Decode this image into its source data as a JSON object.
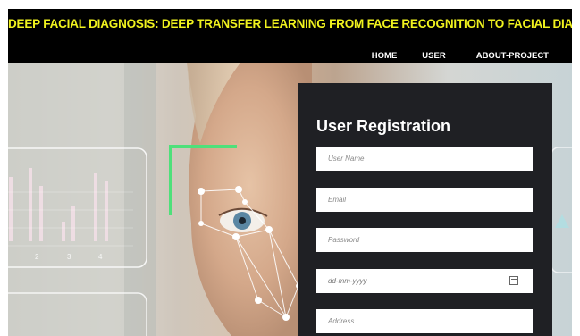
{
  "header": {
    "title": "DEEP FACIAL DIAGNOSIS: DEEP TRANSFER LEARNING FROM FACE RECOGNITION TO FACIAL DIAGNOSIS"
  },
  "nav": {
    "items": [
      {
        "label": "HOME"
      },
      {
        "label": "USER"
      },
      {
        "label": "ABOUT-PROJECT"
      }
    ]
  },
  "hero": {
    "chart_ticks": [
      "2",
      "3",
      "4"
    ],
    "accent_color": "#4ee07a"
  },
  "registration": {
    "title": "User Registration",
    "fields": {
      "username_placeholder": "User Name",
      "email_placeholder": "Email",
      "password_placeholder": "Password",
      "date_placeholder": "dd-mm-yyyy",
      "address_placeholder": "Address"
    },
    "calendar_icon": "calendar-icon"
  }
}
